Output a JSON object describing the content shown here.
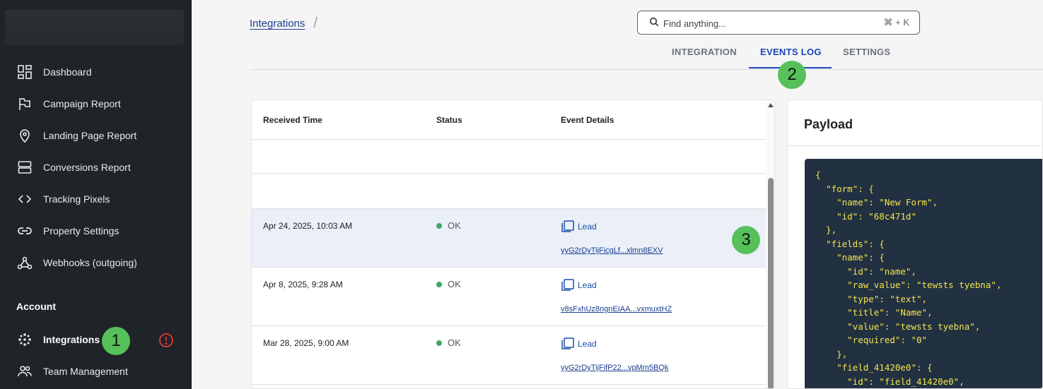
{
  "sidebar": {
    "items": [
      {
        "label": "Dashboard",
        "icon": "dashboard-icon"
      },
      {
        "label": "Campaign Report",
        "icon": "flag-icon"
      },
      {
        "label": "Landing Page Report",
        "icon": "map-pin-icon"
      },
      {
        "label": "Conversions Report",
        "icon": "rows-icon"
      },
      {
        "label": "Tracking Pixels",
        "icon": "code-icon"
      },
      {
        "label": "Property Settings",
        "icon": "link-icon"
      },
      {
        "label": "Webhooks (outgoing)",
        "icon": "webhook-icon"
      }
    ],
    "account_title": "Account",
    "account_items": [
      {
        "label": "Integrations",
        "icon": "integrations-icon",
        "active": true
      },
      {
        "label": "Team Management",
        "icon": "team-icon"
      }
    ]
  },
  "breadcrumb": {
    "link": "Integrations",
    "separator": "/"
  },
  "search": {
    "placeholder": "Find anything...",
    "shortcut": "⌘ + K"
  },
  "tabs": [
    {
      "label": "INTEGRATION"
    },
    {
      "label": "EVENTS LOG",
      "active": true
    },
    {
      "label": "SETTINGS"
    }
  ],
  "badges": [
    "1",
    "2",
    "3"
  ],
  "events": {
    "columns": [
      "Received Time",
      "Status",
      "Event Details"
    ],
    "rows": [
      {
        "time": "Apr 24, 2025, 10:03 AM",
        "status": "OK",
        "type": "Lead",
        "id": "yyG2rDyTijFicgLf...xlmn8EXV",
        "selected": true
      },
      {
        "time": "Apr 8, 2025, 9:28 AM",
        "status": "OK",
        "type": "Lead",
        "id": "v8sFxhUz8ngnEIAA...vxmuxtHZ"
      },
      {
        "time": "Mar 28, 2025, 9:00 AM",
        "status": "OK",
        "type": "Lead",
        "id": "yyG2rDyTijFifP22...vpMm5BQk"
      }
    ]
  },
  "payload": {
    "title": "Payload",
    "code": "{\n  \"form\": {\n    \"name\": \"New Form\",\n    \"id\": \"68c471d\"\n  },\n  \"fields\": {\n    \"name\": {\n      \"id\": \"name\",\n      \"raw_value\": \"tewsts tyebna\",\n      \"type\": \"text\",\n      \"title\": \"Name\",\n      \"value\": \"tewsts tyebna\",\n      \"required\": \"0\"\n    },\n    \"field_41420e0\": {\n      \"id\": \"field_41420e0\","
  },
  "colors": {
    "sidebar_bg": "#1f2428",
    "accent": "#1a46b8",
    "badge": "#56c15a",
    "code_bg": "#213142",
    "code_text": "#f5e44a",
    "status_ok": "#3fa764",
    "alert": "#e53935"
  }
}
